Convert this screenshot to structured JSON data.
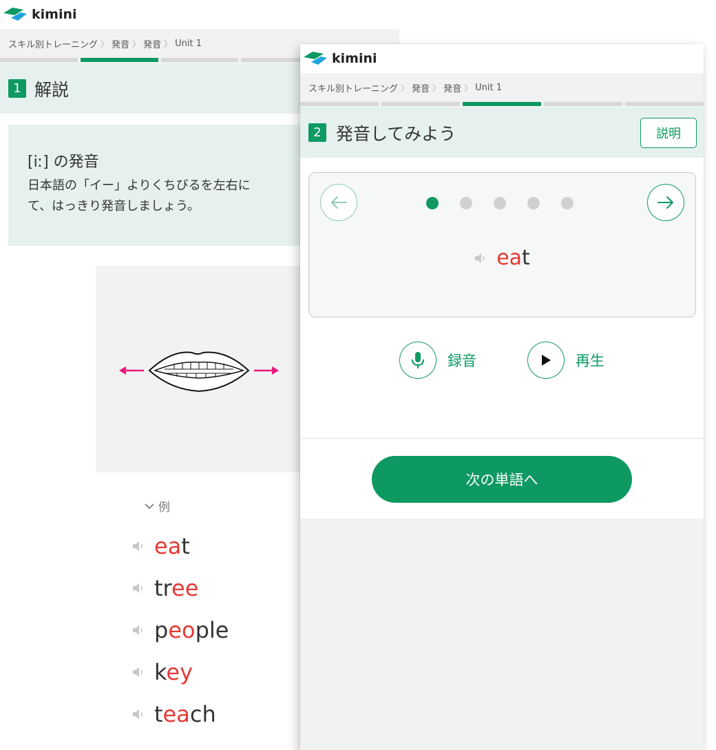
{
  "app": {
    "logo_text": "kimini",
    "brand_color": "#0d9961",
    "highlight_color": "#e53935"
  },
  "breadcrumb": [
    "スキル別トレーニング",
    "発音",
    "発音",
    "Unit 1"
  ],
  "screen1": {
    "section_number": "1",
    "section_title": "解説",
    "explain_title": "[iː] の発音",
    "explain_body": "日本語の「イー」よりくちびるを左右に\nて、はっきり発音しましょう。",
    "illustration": "mouth-spread-lips-icon",
    "examples_label": "例",
    "words": [
      {
        "parts": [
          {
            "t": "ea",
            "hl": true
          },
          {
            "t": "t",
            "hl": false
          }
        ]
      },
      {
        "parts": [
          {
            "t": "tr",
            "hl": false
          },
          {
            "t": "ee",
            "hl": true
          }
        ]
      },
      {
        "parts": [
          {
            "t": "p",
            "hl": false
          },
          {
            "t": "eo",
            "hl": true
          },
          {
            "t": "ple",
            "hl": false
          }
        ]
      },
      {
        "parts": [
          {
            "t": "k",
            "hl": false
          },
          {
            "t": "ey",
            "hl": true
          }
        ]
      },
      {
        "parts": [
          {
            "t": "t",
            "hl": false
          },
          {
            "t": "ea",
            "hl": true
          },
          {
            "t": "ch",
            "hl": false
          }
        ]
      }
    ]
  },
  "screen2": {
    "section_number": "2",
    "section_title": "発音してみよう",
    "explain_button": "説明",
    "dots_total": 5,
    "dot_active_index": 0,
    "current_word": {
      "parts": [
        {
          "t": "ea",
          "hl": true
        },
        {
          "t": "t",
          "hl": false
        }
      ]
    },
    "record_label": "録音",
    "play_label": "再生",
    "next_button": "次の単語へ"
  }
}
